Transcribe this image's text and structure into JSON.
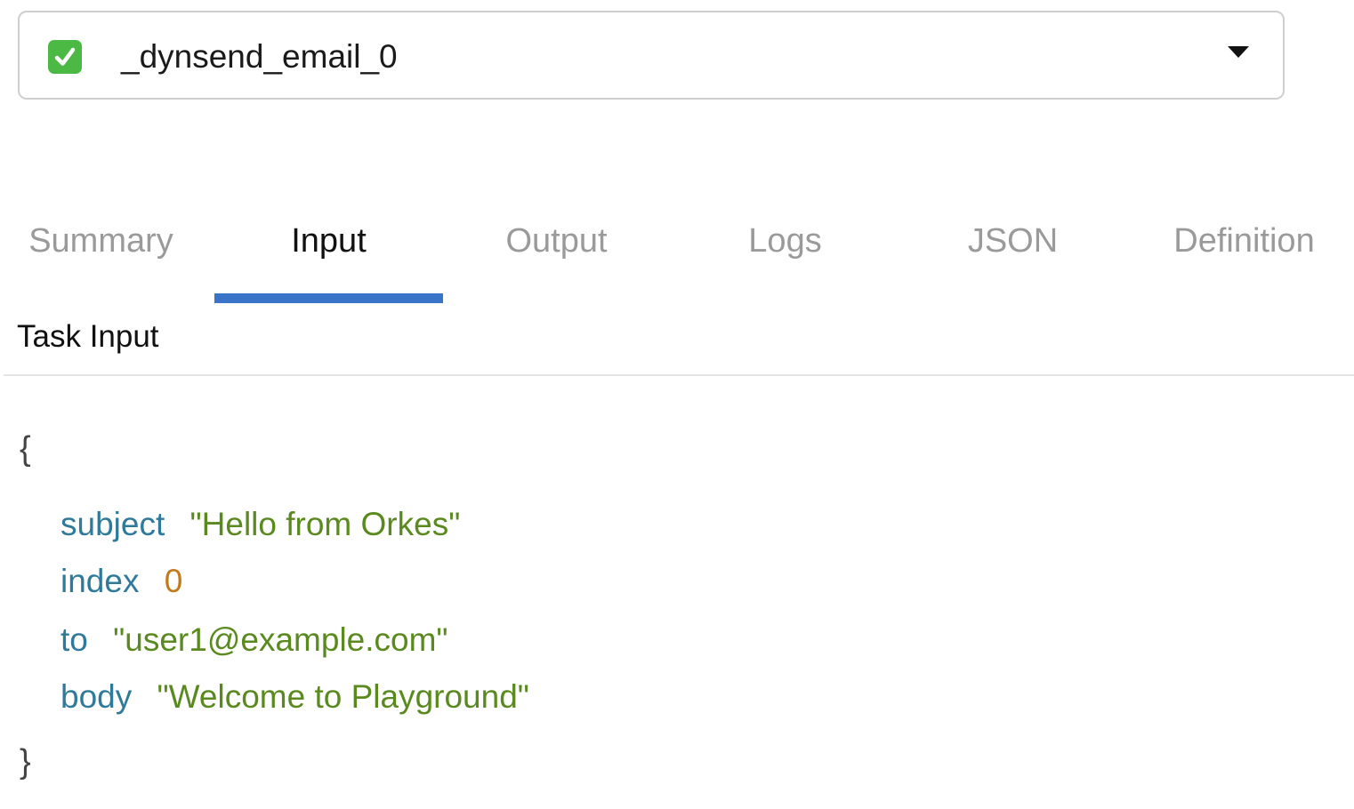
{
  "task_selector": {
    "selected_task": "_dynsend_email_0",
    "status_icon": "check-icon",
    "dropdown_icon": "caret-down-icon",
    "status_color": "#4cb944"
  },
  "tabs": [
    {
      "label": "Summary",
      "active": false
    },
    {
      "label": "Input",
      "active": true
    },
    {
      "label": "Output",
      "active": false
    },
    {
      "label": "Logs",
      "active": false
    },
    {
      "label": "JSON",
      "active": false
    },
    {
      "label": "Definition",
      "active": false
    }
  ],
  "accent_color": "#3a74c9",
  "section": {
    "title": "Task Input"
  },
  "json": {
    "open_brace": "{",
    "close_brace": "}",
    "entries": [
      {
        "key": "subject",
        "value": "\"Hello from Orkes\""
      },
      {
        "key": "index",
        "value": "0"
      },
      {
        "key": "to",
        "value": "\"user1@example.com\""
      },
      {
        "key": "body",
        "value": "\"Welcome to Playground\""
      }
    ]
  }
}
